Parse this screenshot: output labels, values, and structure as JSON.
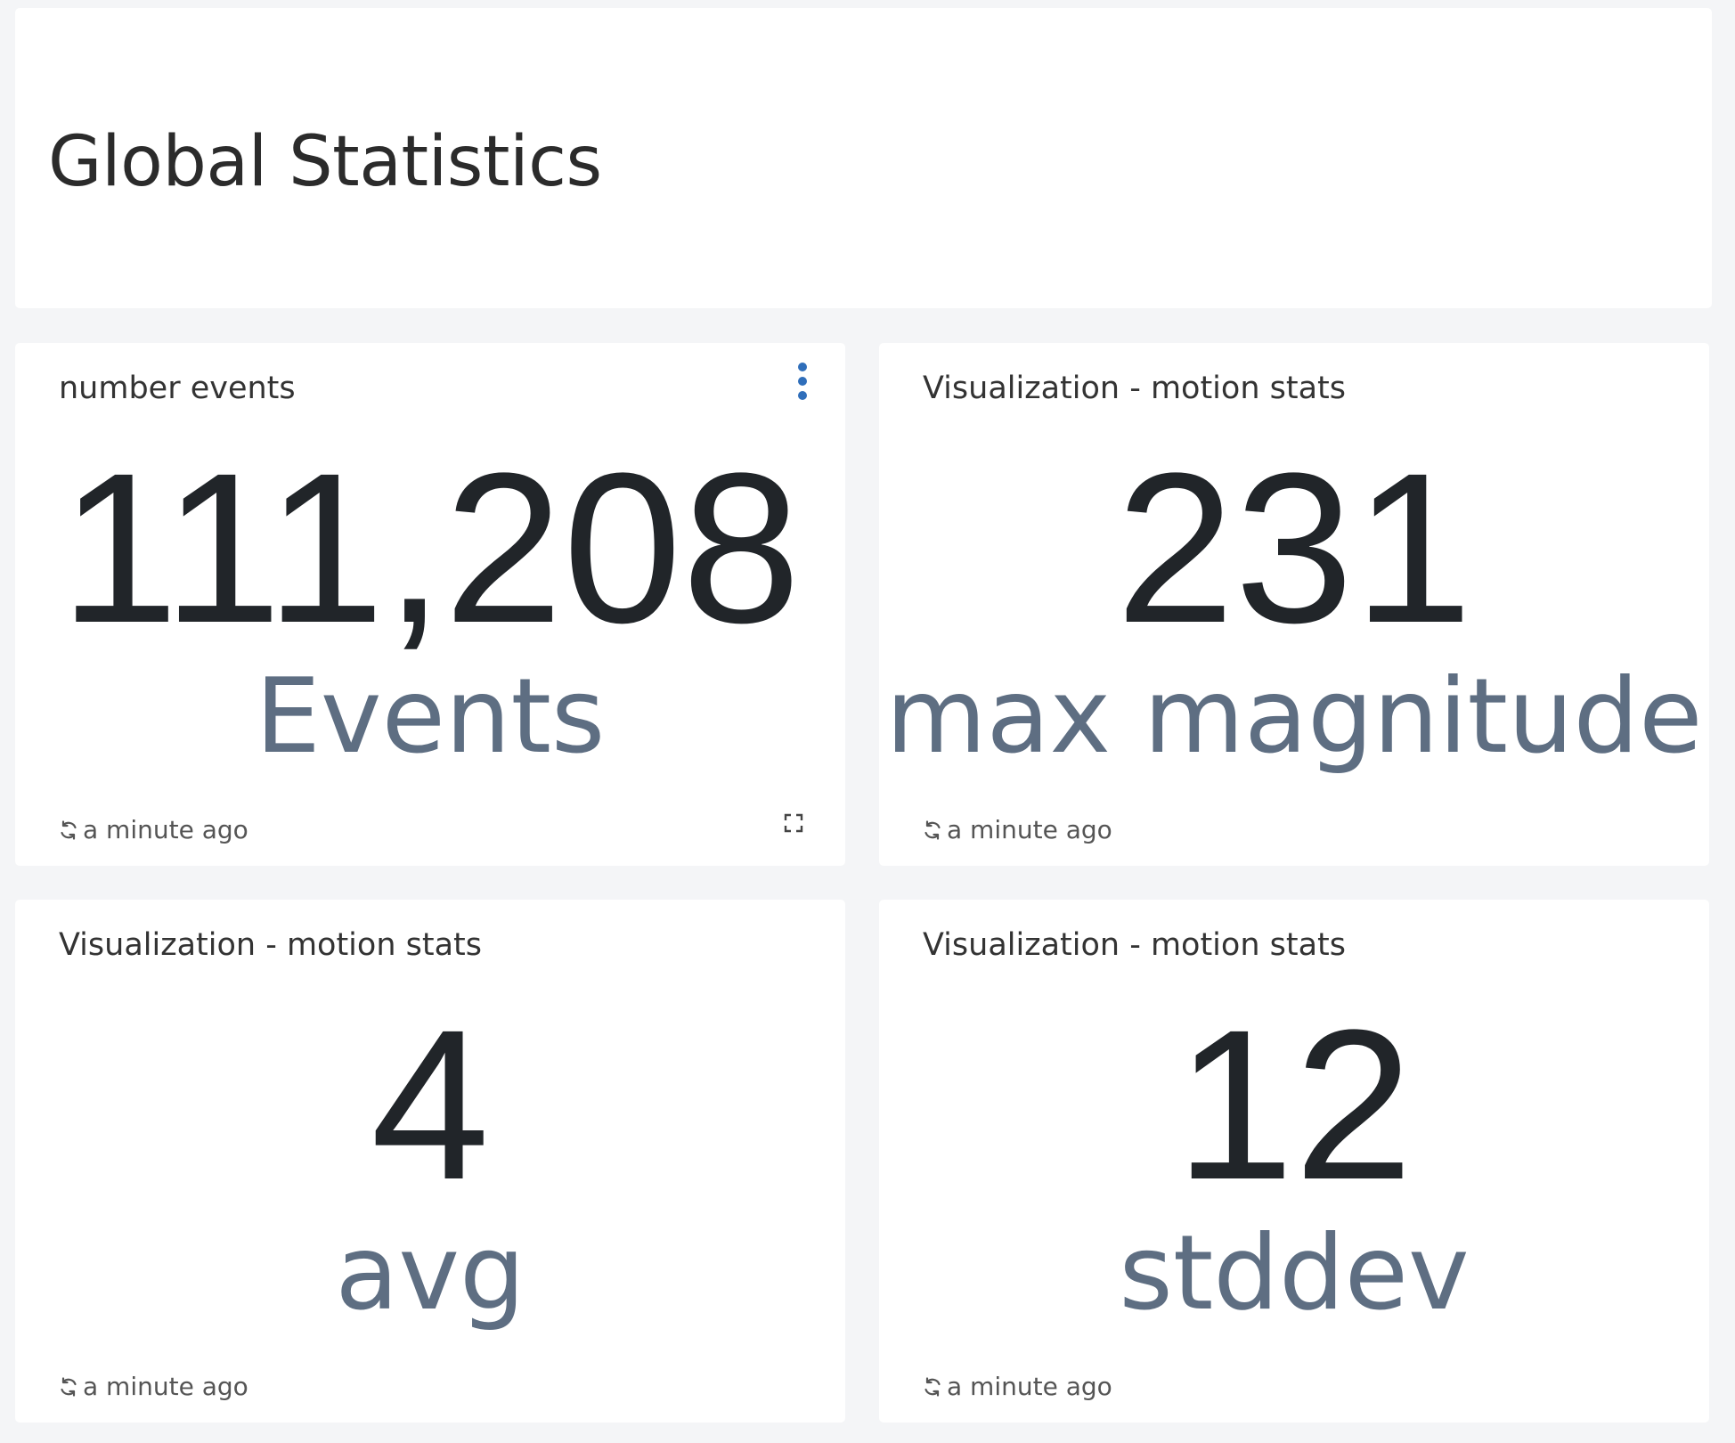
{
  "header": {
    "title": "Global Statistics"
  },
  "widgets": [
    {
      "title": "number events",
      "value": "111,208",
      "label": "Events",
      "refresh_text": "a minute ago"
    },
    {
      "title": "Visualization - motion stats",
      "value": "231",
      "label": "max magnitude",
      "refresh_text": "a minute ago"
    },
    {
      "title": "Visualization - motion stats",
      "value": "4",
      "label": "avg",
      "refresh_text": "a minute ago"
    },
    {
      "title": "Visualization - motion stats",
      "value": "12",
      "label": "stddev",
      "refresh_text": "a minute ago"
    }
  ],
  "icons": {
    "refresh": "refresh-icon",
    "menu": "kebab-menu-icon",
    "expand": "expand-icon"
  },
  "colors": {
    "background": "#f4f5f7",
    "panel": "#ffffff",
    "value_text": "#212529",
    "label_text": "#5e6e82",
    "accent": "#2f6eba"
  }
}
